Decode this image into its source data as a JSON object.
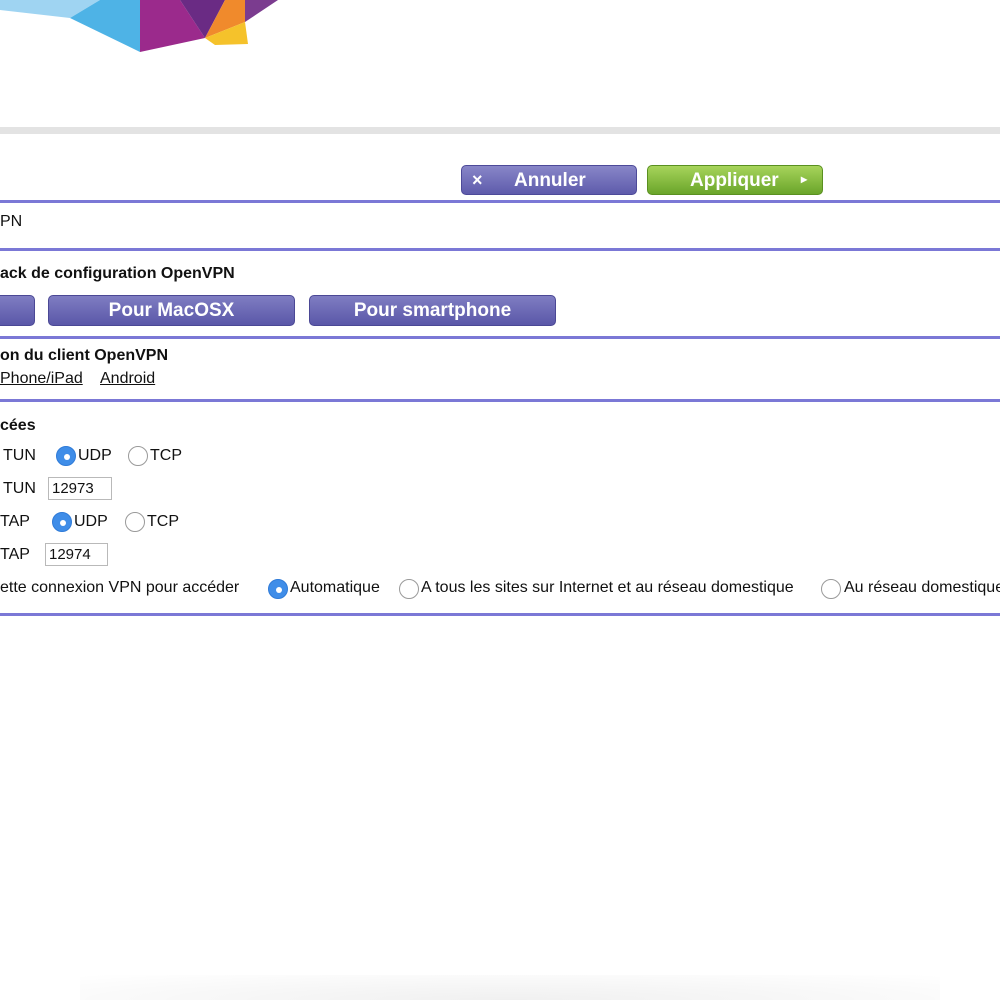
{
  "header": {
    "cancel_label": "Annuler",
    "apply_label": "Appliquer",
    "cancel_icon": "×",
    "apply_icon": "▸"
  },
  "section_title": "PN",
  "config_pack": {
    "heading": "ack de configuration OpenVPN",
    "buttons": [
      "",
      "Pour MacOSX",
      "Pour smartphone"
    ]
  },
  "client": {
    "heading": "on du client OpenVPN",
    "links": [
      "Phone/iPad",
      "Android"
    ]
  },
  "advanced": {
    "heading": "cées",
    "tun_protocol_label": "TUN",
    "tun_port_label": "TUN",
    "tap_protocol_label": "TAP",
    "tap_port_label": "TAP",
    "udp_label": "UDP",
    "tcp_label": "TCP",
    "tun_protocol_selected": "UDP",
    "tap_protocol_selected": "UDP",
    "tun_port": "12973",
    "tap_port": "12974",
    "access_label": "ette connexion VPN pour accéder",
    "access_options": [
      "Automatique",
      "A tous les sites sur Internet et au réseau domestique",
      "Au réseau domestique"
    ],
    "access_selected": "Automatique"
  },
  "colors": {
    "separator": "#7b78d6",
    "cancel_button": "#6e6bb8",
    "apply_button": "#86bf3f",
    "radio_selected": "#3f8de8"
  }
}
